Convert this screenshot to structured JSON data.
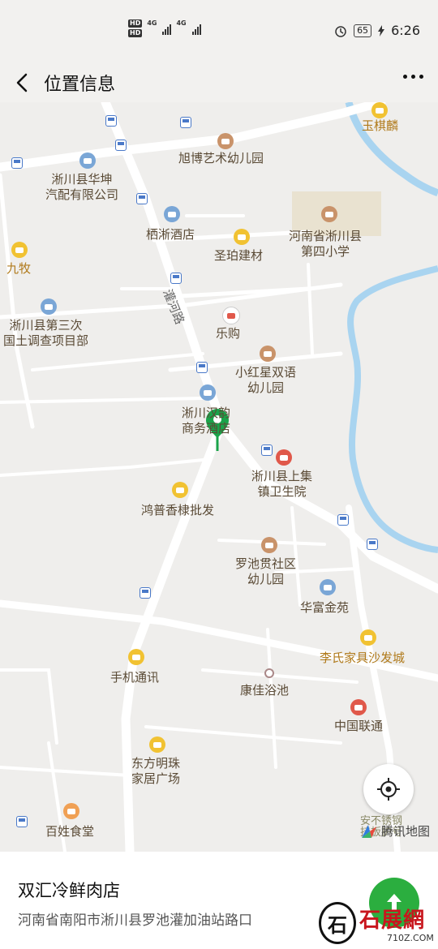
{
  "status_bar": {
    "hd1": "HD",
    "hd2": "HD",
    "net1": "4G",
    "net2": "4G",
    "battery": "65",
    "time": "6:26"
  },
  "header": {
    "title": "位置信息"
  },
  "map": {
    "pois": [
      {
        "label": "玉棋麟"
      },
      {
        "label": "旭博艺术幼儿园"
      },
      {
        "label": "淅川县华坤\n汽配有限公司"
      },
      {
        "label": "栖淅酒店"
      },
      {
        "label": "圣珀建材"
      },
      {
        "label": "河南省淅川县\n第四小学"
      },
      {
        "label": "九牧"
      },
      {
        "label": "灌河路"
      },
      {
        "label": "乐购"
      },
      {
        "label": "淅川县第三次\n国土调查项目部"
      },
      {
        "label": "小红星双语\n幼儿园"
      },
      {
        "label": "淅川汉韵\n商务酒店"
      },
      {
        "label": "淅川县上集\n镇卫生院"
      },
      {
        "label": "鸿普香棣批发"
      },
      {
        "label": "罗池贯社区\n幼儿园"
      },
      {
        "label": "华富金苑"
      },
      {
        "label": "李氏家具沙发城"
      },
      {
        "label": "手机通讯"
      },
      {
        "label": "康佳浴池"
      },
      {
        "label": "中国联通"
      },
      {
        "label": "东方明珠\n家居广场"
      },
      {
        "label": "百姓食堂"
      },
      {
        "label": "安不锈钢\n挂板护号"
      }
    ],
    "provider": "腾讯地图"
  },
  "place": {
    "name": "双汇冷鲜肉店",
    "address": "河南省南阳市淅川县罗池灌加油站路口"
  },
  "watermark": {
    "seal": "石",
    "text": "石展網",
    "site": "710Z.COM"
  },
  "colors": {
    "pin": "#1aa34a",
    "nav_button": "#2bae3f",
    "river": "#a9d4f0",
    "road": "#ffffff"
  }
}
